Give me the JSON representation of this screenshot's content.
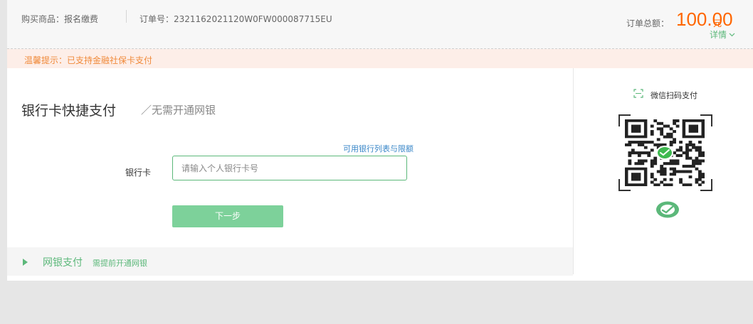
{
  "header": {
    "product": "购买商品：报名缴费",
    "order_no": "订单号：2321162021120W0FW000087715EU",
    "total_label": "订单总额：",
    "total_amount": "100.00",
    "total_unit": "元",
    "detail_label": "详情"
  },
  "notice": {
    "text": "温馨提示：已支持金融社保卡支付"
  },
  "quickpay": {
    "title": "银行卡快捷支付",
    "subtitle": "／无需开通网银",
    "bank_limit_link": "可用银行列表与限额",
    "card_label": "银行卡",
    "card_placeholder": "请输入个人银行卡号",
    "next_button": "下一步"
  },
  "netbank": {
    "title": "网银支付",
    "subtitle": "需提前开通网银"
  },
  "wechat": {
    "scan_label": "微信扫码支付"
  },
  "colors": {
    "accent_green": "#5cb87a",
    "button_green": "#7dd19a",
    "amount_orange": "#ff6600",
    "notice_bg": "#fdeee8",
    "link_blue": "#3a87c8"
  },
  "icons": [
    "scan-icon",
    "chevron-down-icon",
    "qr-code",
    "wechat-icon",
    "play-triangle-icon"
  ]
}
